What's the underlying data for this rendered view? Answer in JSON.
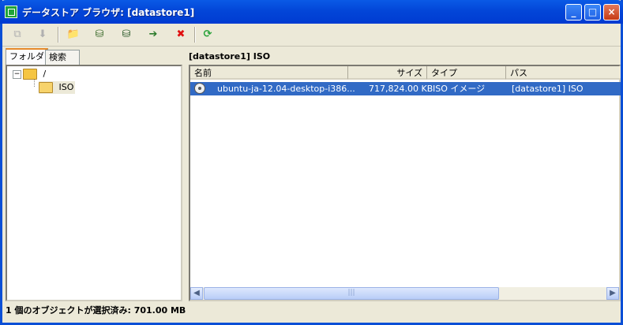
{
  "window": {
    "title": "データストア ブラウザ: [datastore1]"
  },
  "title_buttons": {
    "minimize": "_",
    "maximize": "□",
    "close": "×"
  },
  "toolbar": [
    {
      "name": "upload-folder-icon",
      "glyph": "⧉",
      "disabled": true
    },
    {
      "name": "download-icon",
      "glyph": "⬇",
      "disabled": true
    },
    {
      "name": "new-folder-icon",
      "glyph": "📁",
      "disabled": false
    },
    {
      "name": "upload-icon",
      "glyph": "⛁",
      "disabled": false
    },
    {
      "name": "download-from-datastore-icon",
      "glyph": "⛁",
      "disabled": false
    },
    {
      "name": "register-vm-icon",
      "glyph": "➔",
      "disabled": false
    },
    {
      "name": "delete-icon",
      "glyph": "✖",
      "disabled": false
    },
    {
      "name": "refresh-icon",
      "glyph": "⟳",
      "disabled": false
    }
  ],
  "tabs": [
    "フォルダ",
    "検索"
  ],
  "tree": {
    "root": "/",
    "child": "ISO"
  },
  "current_path": "[datastore1] ISO",
  "columns": [
    "名前",
    "サイズ",
    "タイプ",
    "パス"
  ],
  "files": [
    {
      "name": "ubuntu-ja-12.04-desktop-i386...",
      "size": "717,824.00 KB",
      "type": "ISO イメージ",
      "path": "[datastore1] ISO"
    }
  ],
  "scroll_thumb": "|||",
  "status": "1 個のオブジェクトが選択済み: 701.00 MB",
  "colors": {
    "titlebar": "#0346d8",
    "selection": "#316ac5",
    "face": "#ece9d8"
  }
}
